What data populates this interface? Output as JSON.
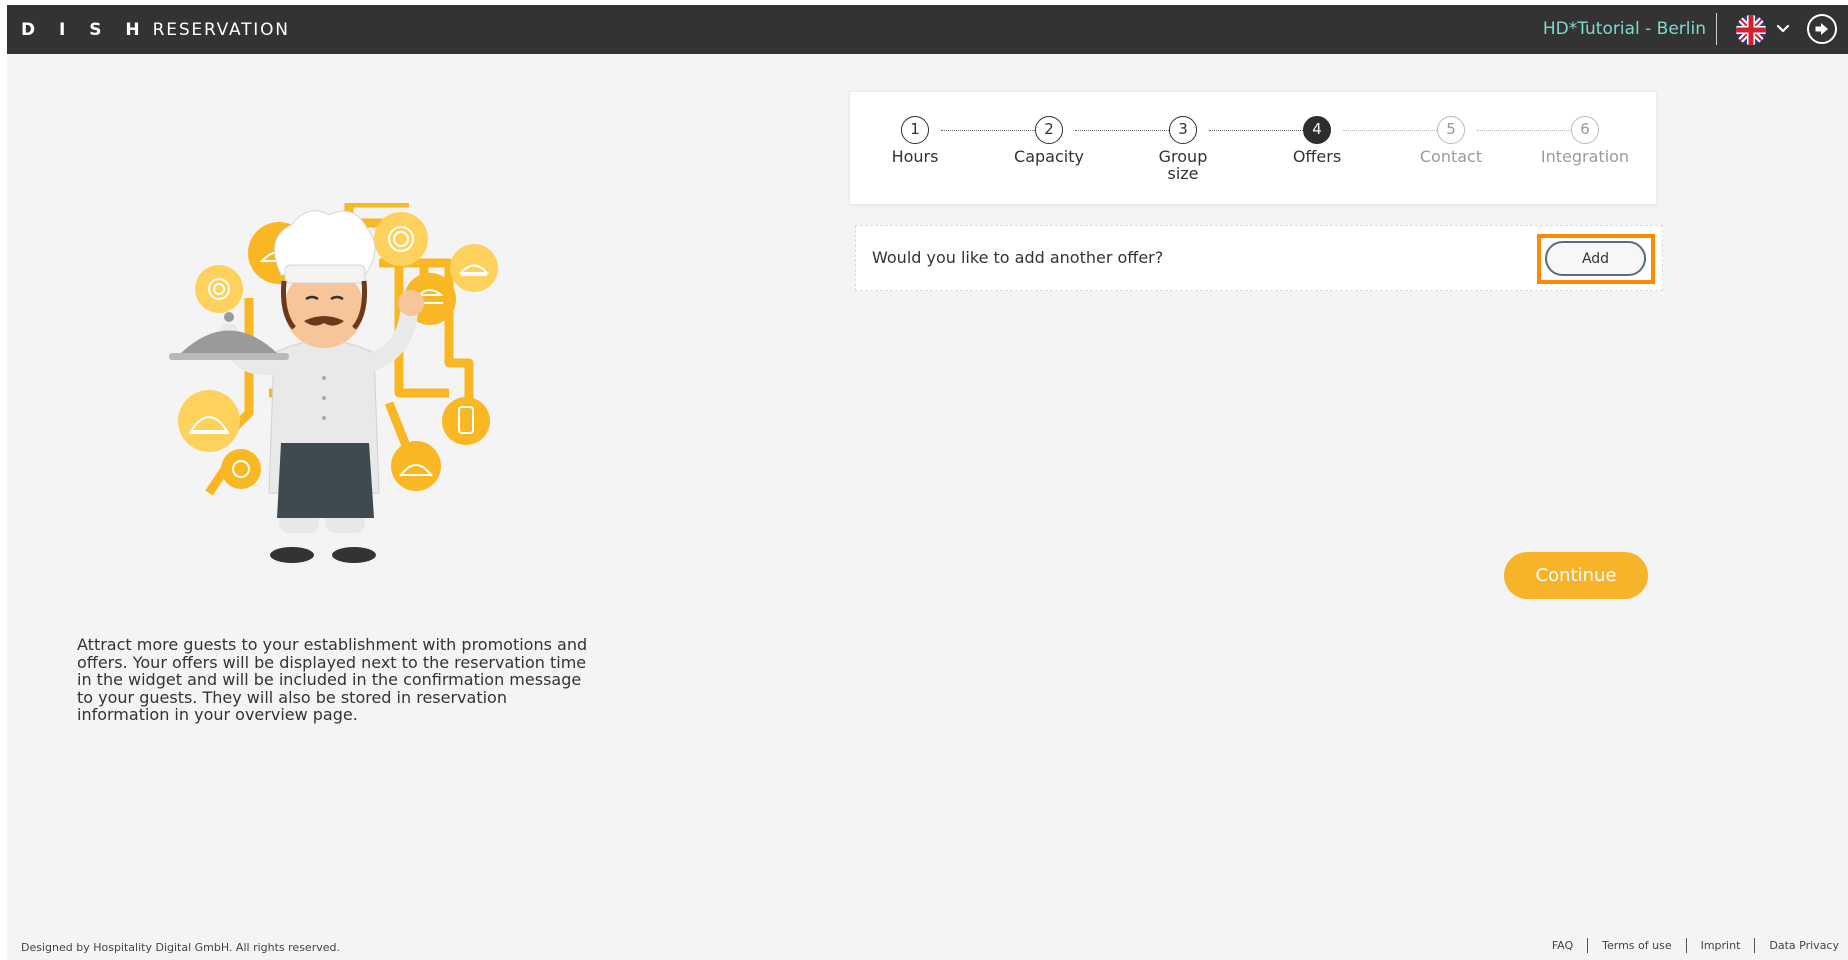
{
  "header": {
    "brand_bold": "D I S H",
    "brand_light": "RESERVATION",
    "tenant": "HD*Tutorial - Berlin",
    "language_icon": "uk-flag-icon",
    "dropdown_icon": "chevron-down-icon",
    "logout_icon": "logout-icon"
  },
  "sidebar": {
    "description": "Attract more guests to your establishment with promotions and offers. Your offers will be displayed next to the reservation time in the widget and will be included in the confirmation message to your guests. They will also be stored in reservation information in your overview page."
  },
  "wizard": {
    "steps": [
      {
        "number": "1",
        "label": "Hours",
        "state": "done"
      },
      {
        "number": "2",
        "label": "Capacity",
        "state": "done"
      },
      {
        "number": "3",
        "label": "Group size",
        "state": "done"
      },
      {
        "number": "4",
        "label": "Offers",
        "state": "active"
      },
      {
        "number": "5",
        "label": "Contact",
        "state": "future"
      },
      {
        "number": "6",
        "label": "Integration",
        "state": "future"
      }
    ]
  },
  "offer": {
    "question": "Would you like to add another offer?",
    "add_label": "Add"
  },
  "actions": {
    "continue_label": "Continue"
  },
  "footer": {
    "copyright": "Designed by Hospitality Digital GmbH. All rights reserved.",
    "links": [
      "FAQ",
      "Terms of use",
      "Imprint",
      "Data Privacy"
    ]
  },
  "colors": {
    "topbar": "#333333",
    "tenant": "#7fd9cc",
    "accent": "#f7b32a",
    "highlight": "#ff8c00"
  }
}
